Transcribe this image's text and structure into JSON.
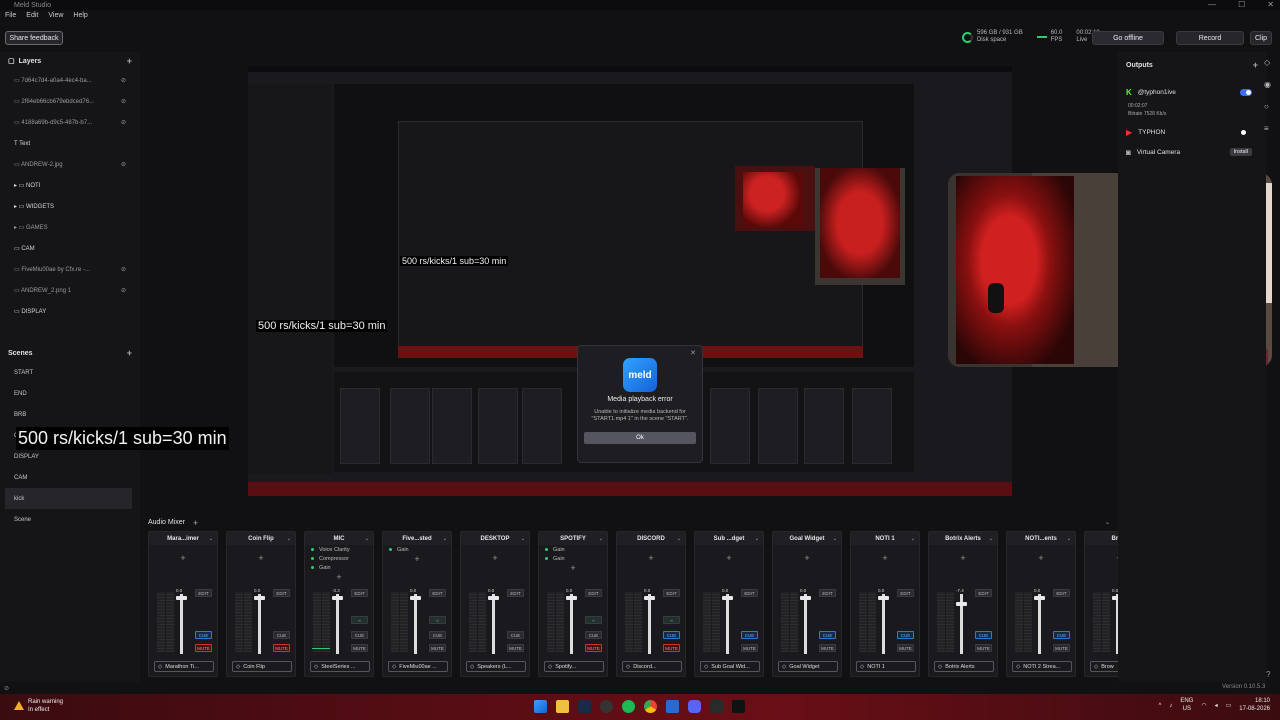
{
  "window": {
    "title": "Meld Studio",
    "controls": [
      "—",
      "☐",
      "✕"
    ]
  },
  "menu": [
    "File",
    "Edit",
    "View",
    "Help"
  ],
  "topbar": {
    "feedback": "Share feedback",
    "disk_value": "596 GB / 931 GB",
    "disk_label": "Disk space",
    "fps_value": "60.0",
    "fps_label": "FPS",
    "live_value": "00:02:10",
    "live_label": "Live",
    "go_offline": "Go offline",
    "record": "Record",
    "clip": "Clip"
  },
  "layers": {
    "title": "Layers",
    "items": [
      "7d64c7d4-a0a4-4ec4-ba...",
      "2f64eb66cb679ebdced76...",
      "4188a69b-d9c5-487b-b7...",
      "Text",
      "ANDREW-2.jpg",
      "NOTI",
      "WIDGETS",
      "GAMES",
      "CAM",
      "FiveMiu00ae by Cfx.re -...",
      "ANDREW_2.png 1",
      "DISPLAY"
    ]
  },
  "scenes": {
    "title": "Scenes",
    "items": [
      "START",
      "END",
      "BRB",
      "GAME",
      "DISPLAY",
      "CAM",
      "kick",
      "Scene"
    ]
  },
  "overlay": {
    "big": "500 rs/kicks/1 sub=30 min",
    "mid": "500 rs/kicks/1 sub=30 min",
    "small": "500 rs/kicks/1 sub=30 min"
  },
  "dialog": {
    "logo": "meld",
    "title": "Media playback error",
    "message": "Unable to initialize media backend for \"START1.mp4 1\" in the scene \"START\".",
    "ok": "Ok"
  },
  "outputs": {
    "title": "Outputs",
    "kick": "@typhon1ive",
    "kick_time": "00:02:07",
    "kick_bitrate": "Bitrate 7528 Kb/s",
    "youtube": "TYPHON",
    "vcam": "Virtual Camera",
    "install": "Install"
  },
  "mixer": {
    "title": "Audio Mixer",
    "strips": [
      {
        "name": "Mara...imer",
        "device": "Marathon Ti...",
        "fx": [],
        "level": "0.0"
      },
      {
        "name": "Coin Flip",
        "device": "Coin Flip",
        "fx": [],
        "level": "0.0"
      },
      {
        "name": "MIC",
        "device": "SteelSeries ...",
        "fx": [
          "Voice Clarity",
          "Compressor",
          "Gain"
        ],
        "level": "-3.3"
      },
      {
        "name": "Five...sted",
        "device": "FiveMiu00ae ...",
        "fx": [
          "Gain"
        ],
        "level": "0.0"
      },
      {
        "name": "DESKTOP",
        "device": "Speakers (L...",
        "fx": [],
        "level": "0.0"
      },
      {
        "name": "SPOTIFY",
        "device": "Spotify...",
        "fx": [
          "Gain",
          "Gain"
        ],
        "level": "0.0"
      },
      {
        "name": "DISCORD",
        "device": "Discord...",
        "fx": [],
        "level": "0.0"
      },
      {
        "name": "Sub ...dget",
        "device": "Sub Goal Wid...",
        "fx": [],
        "level": "0.0"
      },
      {
        "name": "Goal Widget",
        "device": "Goal Widget",
        "fx": [],
        "level": "0.0"
      },
      {
        "name": "NOTI 1",
        "device": "NOTI 1",
        "fx": [],
        "level": "0.0"
      },
      {
        "name": "Botrix Alerts",
        "device": "Botrix Alerts",
        "fx": [],
        "level": "-7.4"
      },
      {
        "name": "NOTI...ents",
        "device": "NOTI 2 Strea...",
        "fx": [],
        "level": "0.0"
      },
      {
        "name": "Brow",
        "device": "Brow",
        "fx": [],
        "level": "0.0"
      }
    ],
    "edit": "EDIT",
    "cue": "CUE",
    "mute": "MUTE"
  },
  "status": {
    "version": "Version 0.10.5.3"
  },
  "taskbar": {
    "weather_title": "Rain warning",
    "weather_sub": "In effect",
    "lang_top": "ENG",
    "lang_bottom": "US",
    "time": "18:10",
    "date": "17-08-2026"
  }
}
